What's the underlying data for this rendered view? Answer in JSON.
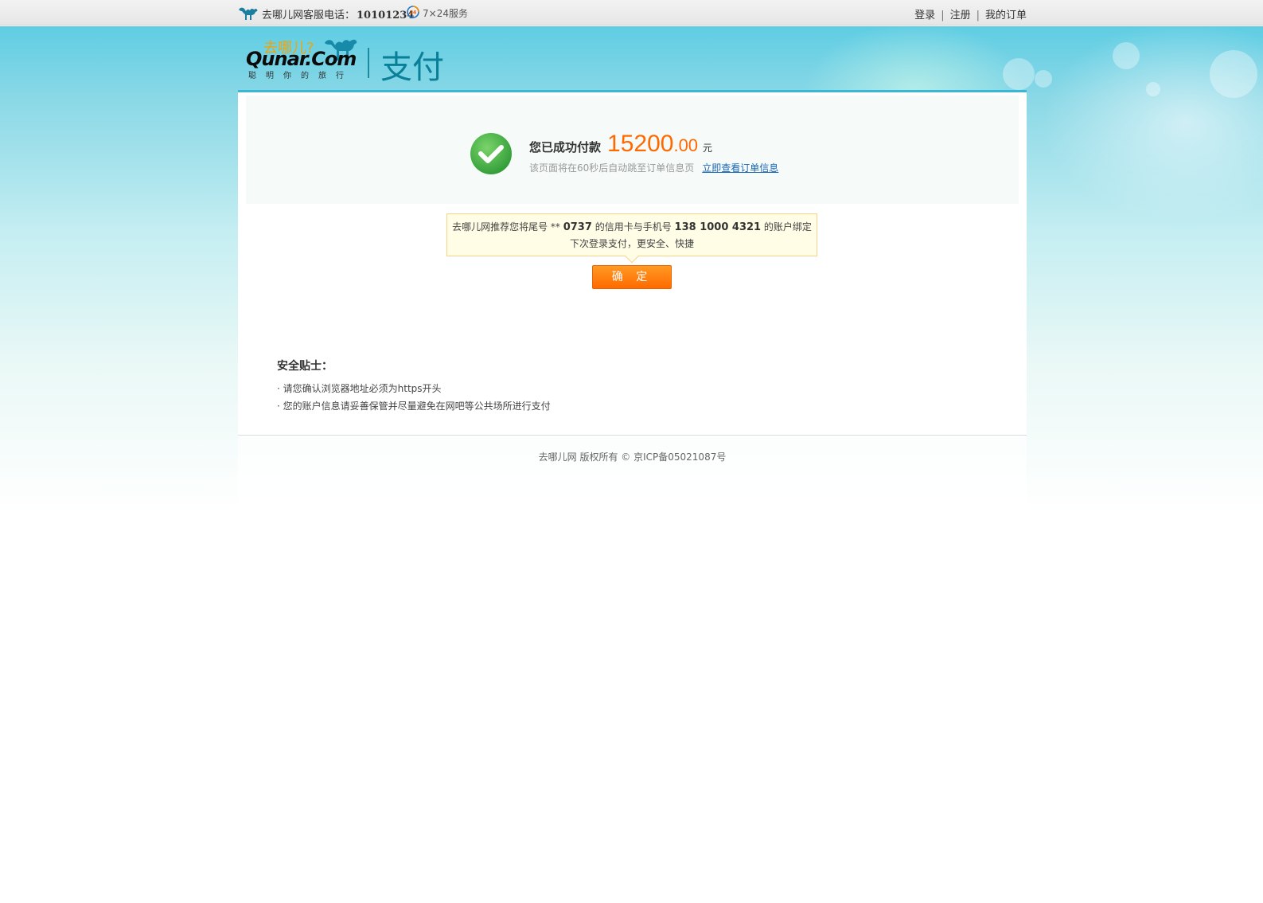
{
  "topbar": {
    "hotline_label": "去哪儿网客服电话：",
    "hotline_number": "10101234",
    "service_label": "7×24服务",
    "links": {
      "login": "登录",
      "register": "注册",
      "my_orders": "我的订单"
    },
    "separator": "|"
  },
  "header": {
    "logo_cn": "去哪儿?",
    "logo_en": "Qunar.Com",
    "logo_slogan": "聪明你的旅行",
    "section_title": "支付"
  },
  "success": {
    "label": "您已成功付款",
    "amount_int": "15200",
    "amount_dec": ".00",
    "currency": "元",
    "redirect_text": "该页面将在60秒后自动跳至订单信息页",
    "view_order_link": "立即查看订单信息"
  },
  "recommend": {
    "part1": "去哪儿网推荐您将尾号 ** ",
    "card_tail": "0737",
    "part2": " 的信用卡与手机号 ",
    "phone": "138 1000 4321",
    "part3": " 的账户绑定",
    "line2": "下次登录支付，更安全、快捷"
  },
  "confirm_button": "确 定",
  "tips": {
    "title": "安全贴士：",
    "items": [
      "请您确认浏览器地址必须为https开头",
      "您的账户信息请妥善保管并尽量避免在网吧等公共场所进行支付"
    ]
  },
  "footer": {
    "copyright": "去哪儿网 版权所有 © 京ICP备05021087号"
  },
  "colors": {
    "accent_orange": "#ff6a00",
    "link_blue": "#1a66b3",
    "header_teal": "#3cb7d3",
    "success_green": "#3aa53a"
  }
}
